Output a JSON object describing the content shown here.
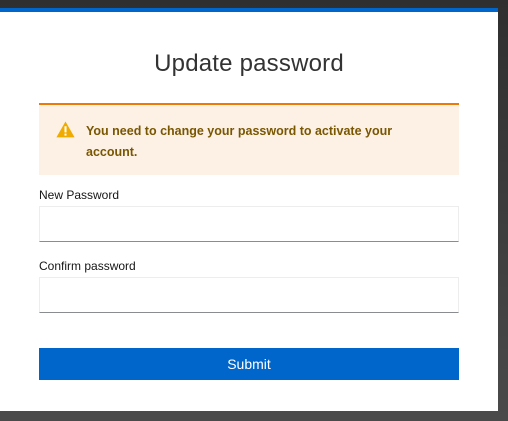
{
  "form": {
    "title": "Update password",
    "alert": {
      "icon": "warning-triangle-icon",
      "message": "You need to change your password to activate your account.",
      "accent_color": "#ec7a08",
      "background_color": "#fdf1e6",
      "text_color": "#795600"
    },
    "new_password": {
      "label": "New Password",
      "value": ""
    },
    "confirm_password": {
      "label": "Confirm password",
      "value": ""
    },
    "submit_label": "Submit",
    "primary_color": "#0066cc"
  }
}
